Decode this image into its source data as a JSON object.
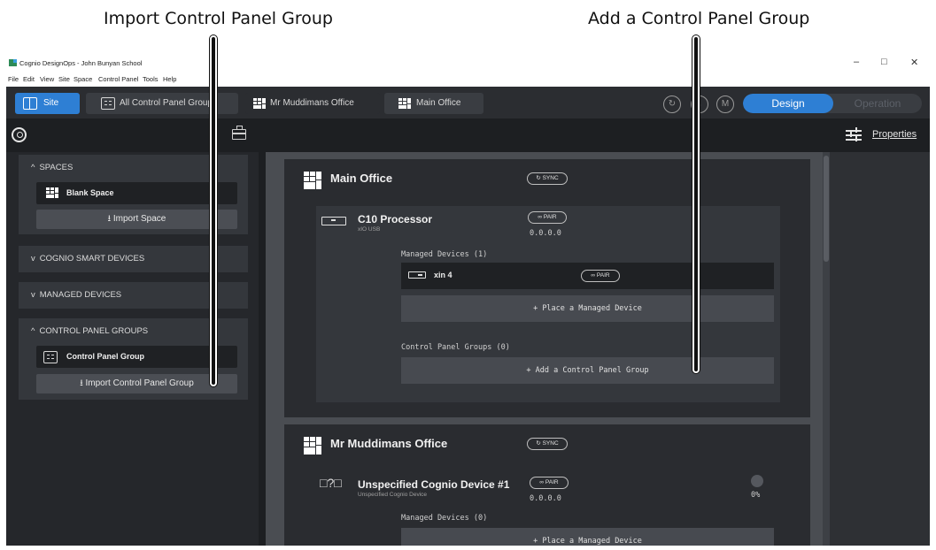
{
  "callouts": {
    "import": "Import Control Panel Group",
    "add": "Add a Control Panel Group"
  },
  "window": {
    "title": "Cognio DesignOps - John Bunyan School",
    "controls": [
      "–",
      "□",
      "✕"
    ]
  },
  "menu": [
    "File",
    "Edit",
    "View",
    "Site",
    "Space",
    "Control Panel",
    "Tools",
    "Help"
  ],
  "tabs": {
    "site": "Site",
    "all_groups": "All Control Panel Groups",
    "mr_muddimans": "Mr Muddimans Office",
    "main_office": "Main Office"
  },
  "toolbar": {
    "sync_icon": "↻",
    "download_icon": "↓",
    "user_initial": "M",
    "mode_design": "Design",
    "mode_operation": "Operation"
  },
  "sidebar": {
    "spaces": {
      "header": "SPACES",
      "chevron": "^",
      "item": "Blank Space",
      "import_button": "⭳ Import Space"
    },
    "smart_devices": {
      "header": "COGNIO SMART DEVICES",
      "chevron": "v"
    },
    "managed_devices": {
      "header": "MANAGED DEVICES",
      "chevron": "v"
    },
    "control_panel_groups": {
      "header": "CONTROL PANEL GROUPS",
      "chevron": "^",
      "item": "Control Panel Group",
      "import_button": "⭳ Import Control Panel Group"
    }
  },
  "properties_label": "Properties",
  "spaces": [
    {
      "name": "Main Office",
      "sync": "SYNC",
      "device": {
        "name": "C10 Processor",
        "subtitle": "xIO USB",
        "pair": "PAIR",
        "ip": "0.0.0.0",
        "managed_label": "Managed Devices (1)",
        "managed_item": {
          "name": "xin 4",
          "pair": "PAIR"
        },
        "place_button": "+ Place a Managed Device",
        "groups_label": "Control Panel Groups (0)",
        "add_group_button": "+ Add a Control Panel Group"
      }
    },
    {
      "name": "Mr Muddimans Office",
      "sync": "SYNC",
      "device": {
        "name": "Unspecified Cognio Device #1",
        "subtitle": "Unspecified Cognio Device",
        "pair": "PAIR",
        "ip": "0.0.0.0",
        "status_percent": "0%",
        "managed_label": "Managed Devices (0)",
        "place_button": "+ Place a Managed Device"
      }
    }
  ],
  "colors": {
    "accent": "#2e7fd4",
    "background": "#1d1f22",
    "panel": "#34373c"
  }
}
